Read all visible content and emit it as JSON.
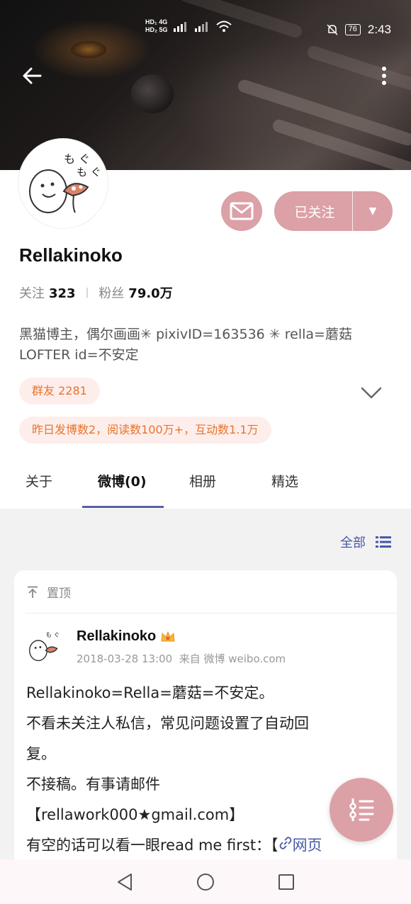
{
  "status_bar": {
    "network1": "HD₁ 4G",
    "network2": "HD₂ 5G",
    "battery": "76",
    "time": "2:43"
  },
  "profile": {
    "name": "Rellakinoko",
    "following_label": "关注",
    "following_count": "323",
    "followers_label": "粉丝",
    "followers_count": "79.0万",
    "bio_line1": "黑猫博主，偶尔画画✳ pixivID=163536 ✳ rella=蘑菇",
    "bio_line2": "LOFTER id=不安定",
    "group_badge": "群友 2281",
    "activity_badge": "昨日发博数2，阅读数100万+，互动数1.1万",
    "follow_button": "已关注"
  },
  "tabs": [
    {
      "label": "关于"
    },
    {
      "label": "微博(0)"
    },
    {
      "label": "相册"
    },
    {
      "label": "精选"
    }
  ],
  "filter": {
    "label": "全部"
  },
  "post": {
    "pinned_label": "置顶",
    "author": "Rellakinoko",
    "date": "2018-03-28 13:00",
    "source": "来自 微博 weibo.com",
    "lines": [
      "Rellakinoko=Rella=蘑菇=不安定。",
      "不看未关注人私信，常见问题设置了自动回",
      "复。",
      "不接稿。有事请邮件",
      "【rellawork000★gmail.com】",
      "有空的话可以看一眼read me first：【"
    ],
    "link_text": "网页"
  },
  "colors": {
    "accent_pink": "#dca0a7",
    "tab_indicator": "#5a5fa8",
    "link_blue": "#4a58a6",
    "badge_orange": "#e8742a"
  }
}
